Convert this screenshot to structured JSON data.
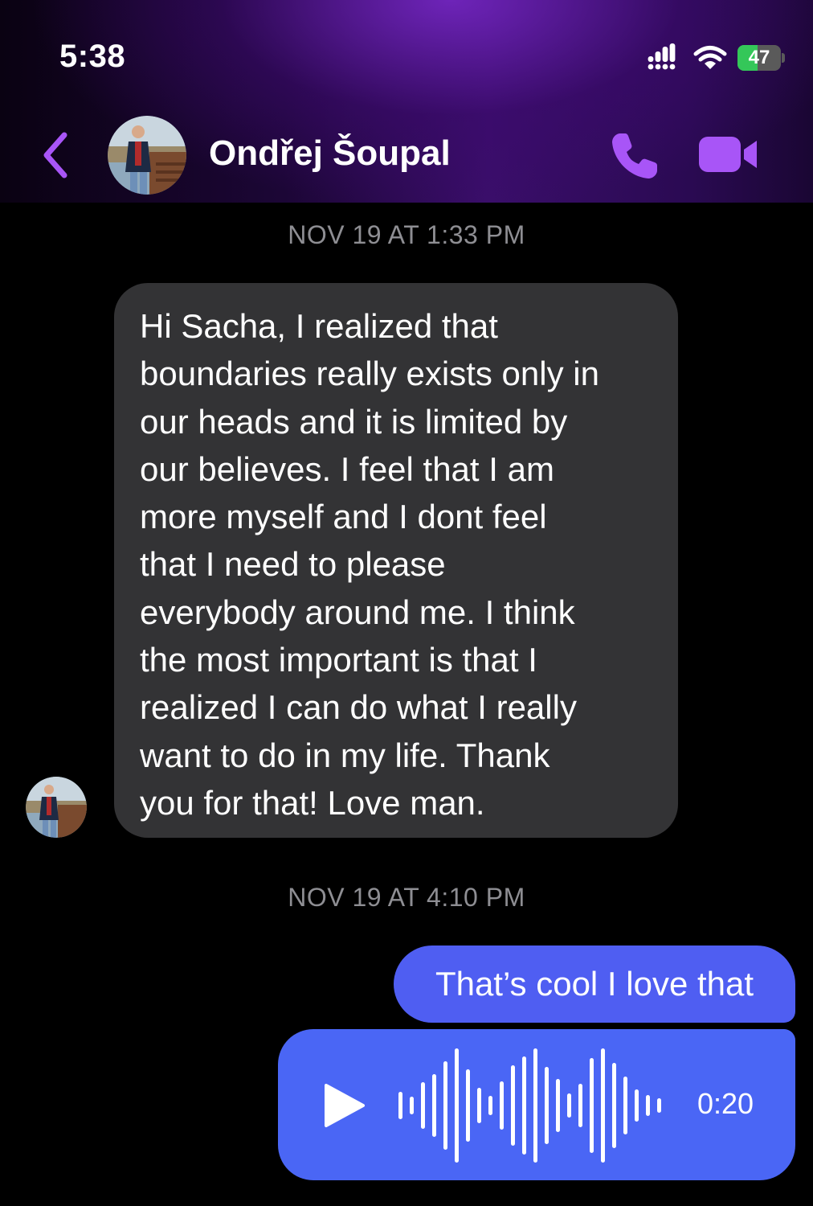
{
  "status_bar": {
    "time": "5:38",
    "battery_level": "47",
    "battery_fraction": 0.47,
    "icons": [
      "signal-icon",
      "wifi-icon",
      "battery-charging-icon"
    ]
  },
  "header": {
    "contact_name": "Ondřej Šoupal",
    "icons": [
      "chevron-left-icon",
      "phone-icon",
      "video-camera-icon"
    ],
    "accent_color": "#a855f7"
  },
  "conversation": {
    "timestamps": [
      "NOV 19 AT 1:33 PM",
      "NOV 19 AT 4:10 PM"
    ],
    "incoming_message": {
      "text": "Hi Sacha, I realized that\nboundaries really exists only in\nour heads and it is limited by\nour believes. I feel that I am\nmore myself and I dont feel\nthat I need to please\neverybody around me. I think\nthe most important is that I\nrealized I can do what I really\nwant to do in my life. Thank\nyou for that! Love man.",
      "bubble_color": "#333335"
    },
    "outgoing_message": {
      "text": "That’s cool I love that",
      "bubble_color": "#4f5ef2"
    },
    "voice_message": {
      "duration": "0:20",
      "bubble_color": "#4a66f5",
      "icons": [
        "play-icon",
        "waveform-icon"
      ]
    }
  }
}
